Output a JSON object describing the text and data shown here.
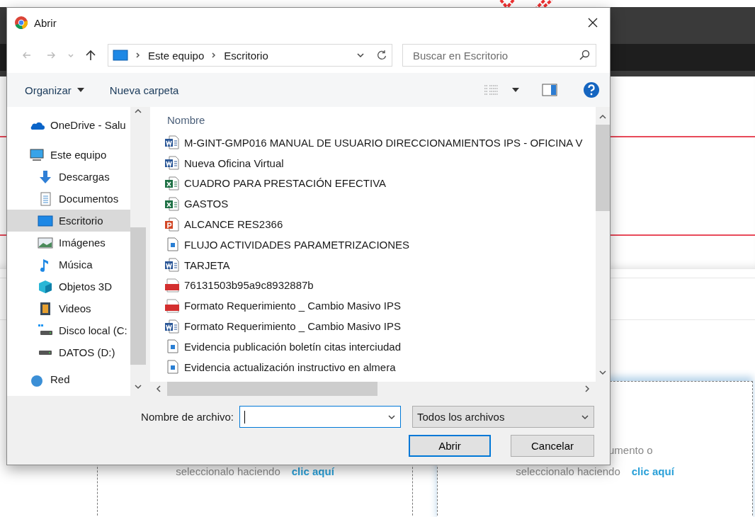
{
  "dialog": {
    "title": "Abrir",
    "breadcrumb": [
      "Este equipo",
      "Escritorio"
    ],
    "search": {
      "placeholder": "Buscar en Escritorio"
    },
    "toolbar": [
      "Organizar",
      "Nueva carpeta"
    ],
    "nav": [
      {
        "label": "OneDrive - Salu",
        "kind": "onedrive",
        "selected": false
      },
      {
        "label": "Este equipo",
        "kind": "pc",
        "selected": false,
        "children": [
          {
            "label": "Descargas",
            "kind": "downloads",
            "selected": false
          },
          {
            "label": "Documentos",
            "kind": "documents",
            "selected": false
          },
          {
            "label": "Escritorio",
            "kind": "desktop",
            "selected": true
          },
          {
            "label": "Imágenes",
            "kind": "pictures",
            "selected": false
          },
          {
            "label": "Música",
            "kind": "music",
            "selected": false
          },
          {
            "label": "Objetos 3D",
            "kind": "objects",
            "selected": false
          },
          {
            "label": "Videos",
            "kind": "videos",
            "selected": false
          },
          {
            "label": "Disco local (C:",
            "kind": "system-drive",
            "selected": false
          },
          {
            "label": "DATOS (D:)",
            "kind": "drive",
            "selected": false
          }
        ]
      },
      {
        "label": "Red",
        "kind": "network",
        "selected": false
      }
    ],
    "column": "Nombre",
    "files": [
      {
        "name": "M-GINT-GMP016 MANUAL DE USUARIO DIRECCIONAMIENTOS IPS - OFICINA V",
        "kind": "word"
      },
      {
        "name": "Nueva Oficina Virtual",
        "kind": "word"
      },
      {
        "name": "CUADRO PARA PRESTACIÓN EFECTIVA",
        "kind": "excel"
      },
      {
        "name": "GASTOS",
        "kind": "excel"
      },
      {
        "name": "ALCANCE RES2366",
        "kind": "powerpoint"
      },
      {
        "name": "FLUJO ACTIVIDADES PARAMETRIZACIONES",
        "kind": "image"
      },
      {
        "name": "TARJETA",
        "kind": "word"
      },
      {
        "name": "76131503b95a9c8932887b",
        "kind": "pdf"
      },
      {
        "name": "Formato Requerimiento _ Cambio Masivo IPS",
        "kind": "pdf"
      },
      {
        "name": "Formato Requerimiento _ Cambio Masivo IPS",
        "kind": "word"
      },
      {
        "name": "Evidencia publicación boletín citas interciudad",
        "kind": "image"
      },
      {
        "name": "Evidencia actualización instructivo en almera",
        "kind": "image"
      }
    ],
    "filename_label": "Nombre de archivo:",
    "filter": "Todos los archivos",
    "buttons": [
      {
        "label": "Abrir",
        "default": true
      },
      {
        "label": "Cancelar",
        "default": false
      }
    ]
  },
  "page": {
    "partial_text": "umento o",
    "uploads": [
      {
        "text": "seleccionalo haciendo",
        "link": "clic aquí"
      },
      {
        "text": "seleccionalo haciendo",
        "link": "clic aquí"
      }
    ]
  }
}
